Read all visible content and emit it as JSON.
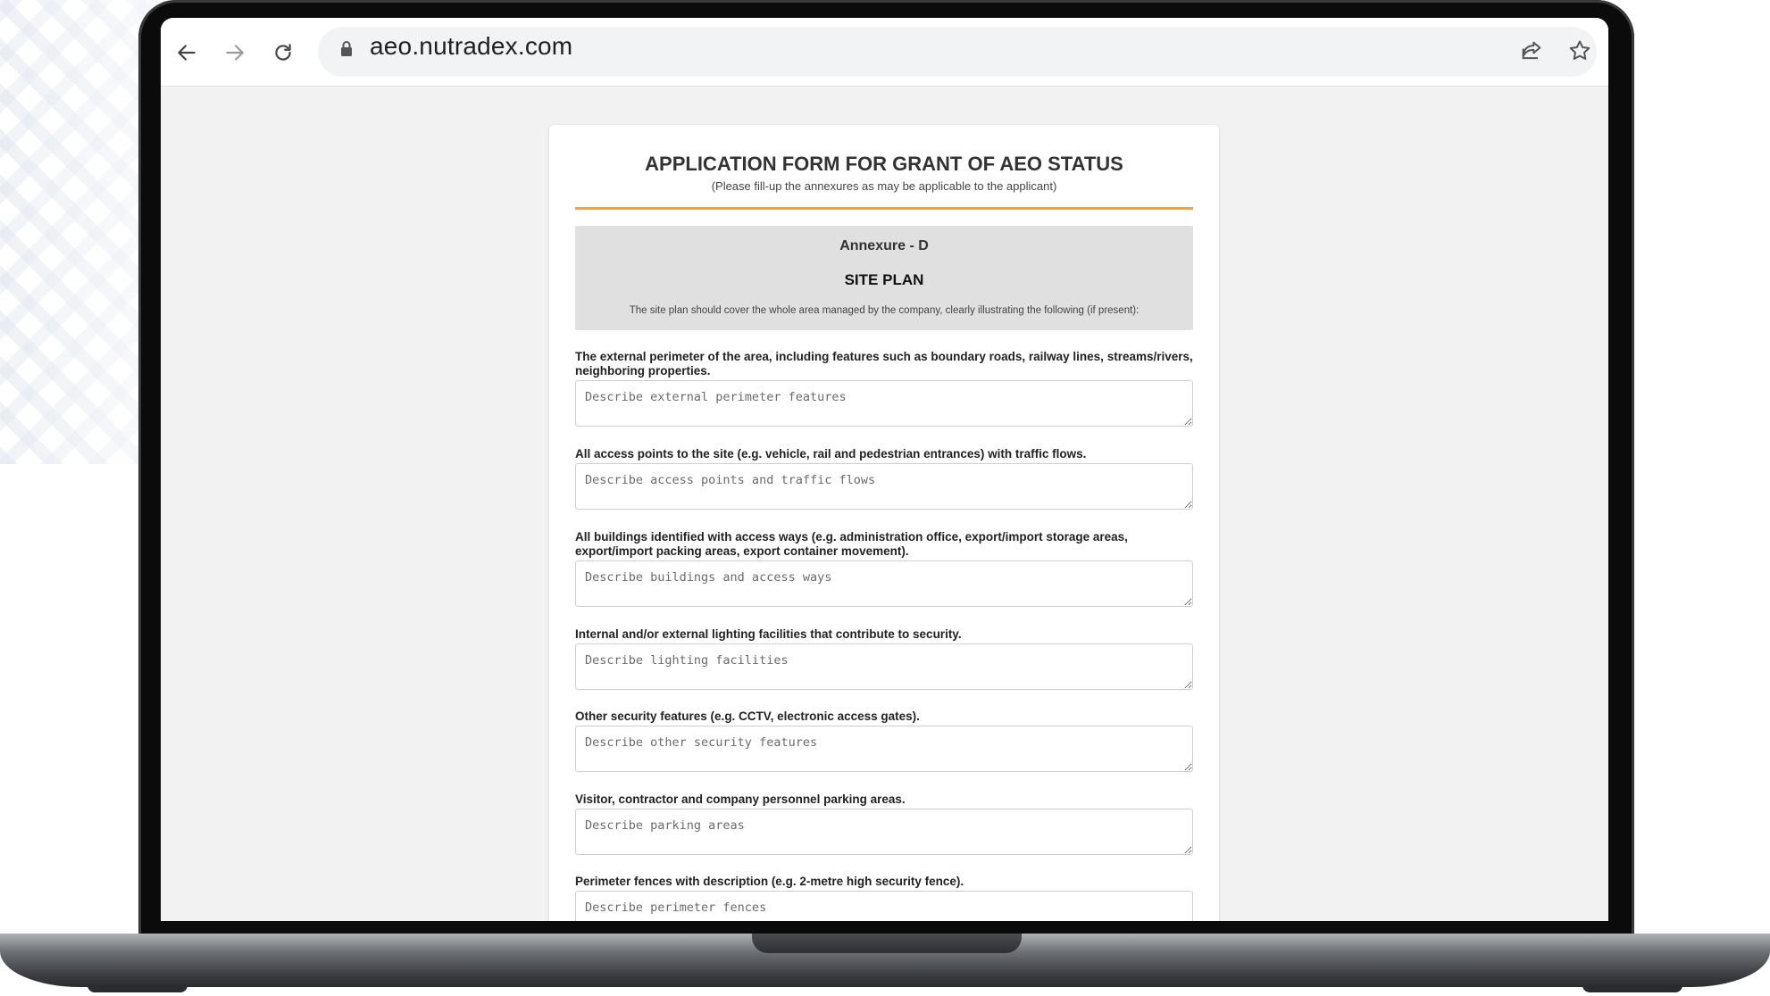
{
  "browser": {
    "url": "aeo.nutradex.com",
    "icons": [
      "back-arrow-icon",
      "forward-arrow-icon",
      "reload-icon",
      "lock-icon",
      "share-icon",
      "bookmark-star-icon"
    ]
  },
  "form": {
    "title": "APPLICATION FORM FOR GRANT OF AEO STATUS",
    "subtitle": "(Please fill-up the annexures as may be applicable to the applicant)",
    "accent_color": "#f0a640"
  },
  "annexure": {
    "label": "Annexure - D",
    "heading": "SITE PLAN",
    "note": "The site plan should cover the whole area managed by the company, clearly illustrating the following (if present):"
  },
  "fields": [
    {
      "label": "The external perimeter of the area, including features such as boundary roads, railway lines, streams/rivers, neighboring properties.",
      "placeholder": "Describe external perimeter features",
      "value": ""
    },
    {
      "label": "All access points to the site (e.g. vehicle, rail and pedestrian entrances) with traffic flows.",
      "placeholder": "Describe access points and traffic flows",
      "value": ""
    },
    {
      "label": "All buildings identified with access ways (e.g. administration office, export/import storage areas, export/import packing areas, export container movement).",
      "placeholder": "Describe buildings and access ways",
      "value": ""
    },
    {
      "label": "Internal and/or external lighting facilities that contribute to security.",
      "placeholder": "Describe lighting facilities",
      "value": ""
    },
    {
      "label": "Other security features (e.g. CCTV, electronic access gates).",
      "placeholder": "Describe other security features",
      "value": ""
    },
    {
      "label": "Visitor, contractor and company personnel parking areas.",
      "placeholder": "Describe parking areas",
      "value": ""
    },
    {
      "label": "Perimeter fences with description (e.g. 2-metre high security fence).",
      "placeholder": "Describe perimeter fences",
      "value": ""
    }
  ]
}
